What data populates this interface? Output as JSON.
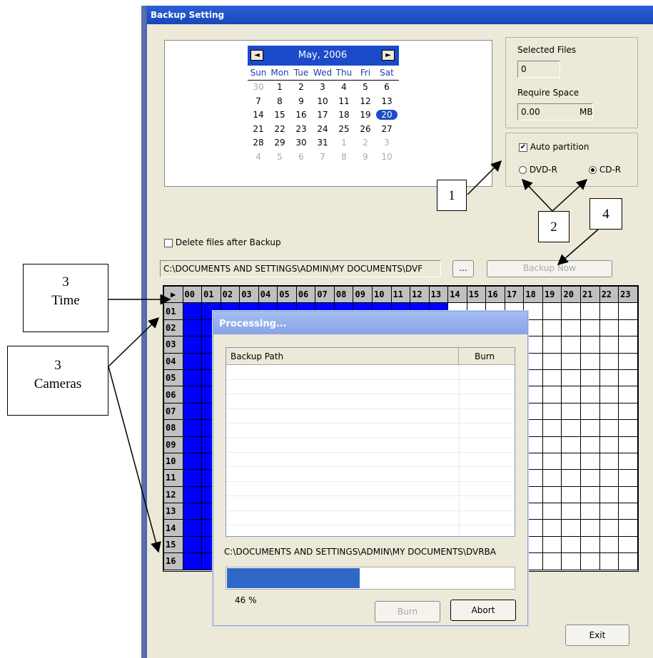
{
  "window": {
    "title": "Backup Setting"
  },
  "calendar": {
    "month_label": "May, 2006",
    "prev_icon": "◄",
    "next_icon": "►",
    "days_of_week": [
      "Sun",
      "Mon",
      "Tue",
      "Wed",
      "Thu",
      "Fri",
      "Sat"
    ],
    "weeks": [
      [
        "30",
        "1",
        "2",
        "3",
        "4",
        "5",
        "6"
      ],
      [
        "7",
        "8",
        "9",
        "10",
        "11",
        "12",
        "13"
      ],
      [
        "14",
        "15",
        "16",
        "17",
        "18",
        "19",
        "20"
      ],
      [
        "21",
        "22",
        "23",
        "24",
        "25",
        "26",
        "27"
      ],
      [
        "28",
        "29",
        "30",
        "31",
        "1",
        "2",
        "3"
      ],
      [
        "4",
        "5",
        "6",
        "7",
        "8",
        "9",
        "10"
      ]
    ],
    "selected_day": "20"
  },
  "summary": {
    "selected_files_label": "Selected Files",
    "selected_files_value": "0",
    "require_space_label": "Require Space",
    "require_space_value": "0.00",
    "require_space_unit": "MB"
  },
  "media": {
    "auto_partition_label": "Auto partition",
    "auto_partition_checked": true,
    "dvd_label": "DVD-R",
    "cd_label": "CD-R",
    "selected": "CD-R"
  },
  "options": {
    "delete_after_label": "Delete files after Backup",
    "delete_after_checked": false
  },
  "path": {
    "value": "C:\\DOCUMENTS AND SETTINGS\\ADMIN\\MY DOCUMENTS\\DVF",
    "browse_label": "...",
    "backup_now_label": "Backup Now"
  },
  "grid": {
    "hours": [
      "00",
      "01",
      "02",
      "03",
      "04",
      "05",
      "06",
      "07",
      "08",
      "09",
      "10",
      "11",
      "12",
      "13",
      "14",
      "15",
      "16",
      "17",
      "18",
      "19",
      "20",
      "21",
      "22",
      "23"
    ],
    "cameras": [
      "01",
      "02",
      "03",
      "04",
      "05",
      "06",
      "07",
      "08",
      "09",
      "10",
      "11",
      "12",
      "13",
      "14",
      "15",
      "16"
    ],
    "selected_hours_end": 14,
    "corner_icon": "▶"
  },
  "processing": {
    "title": "Processing...",
    "col_path": "Backup Path",
    "col_burn": "Burn",
    "path_text": "C:\\DOCUMENTS AND SETTINGS\\ADMIN\\MY DOCUMENTS\\DVRBA",
    "progress_pct": 46,
    "progress_text": "46  %",
    "burn_label": "Burn",
    "abort_label": "Abort"
  },
  "exit_label": "Exit",
  "callouts": {
    "c1": "1",
    "c2": "2",
    "c3_time_num": "3",
    "c3_time_label": "Time",
    "c3_cam_num": "3",
    "c3_cam_label": "Cameras",
    "c4": "4"
  }
}
